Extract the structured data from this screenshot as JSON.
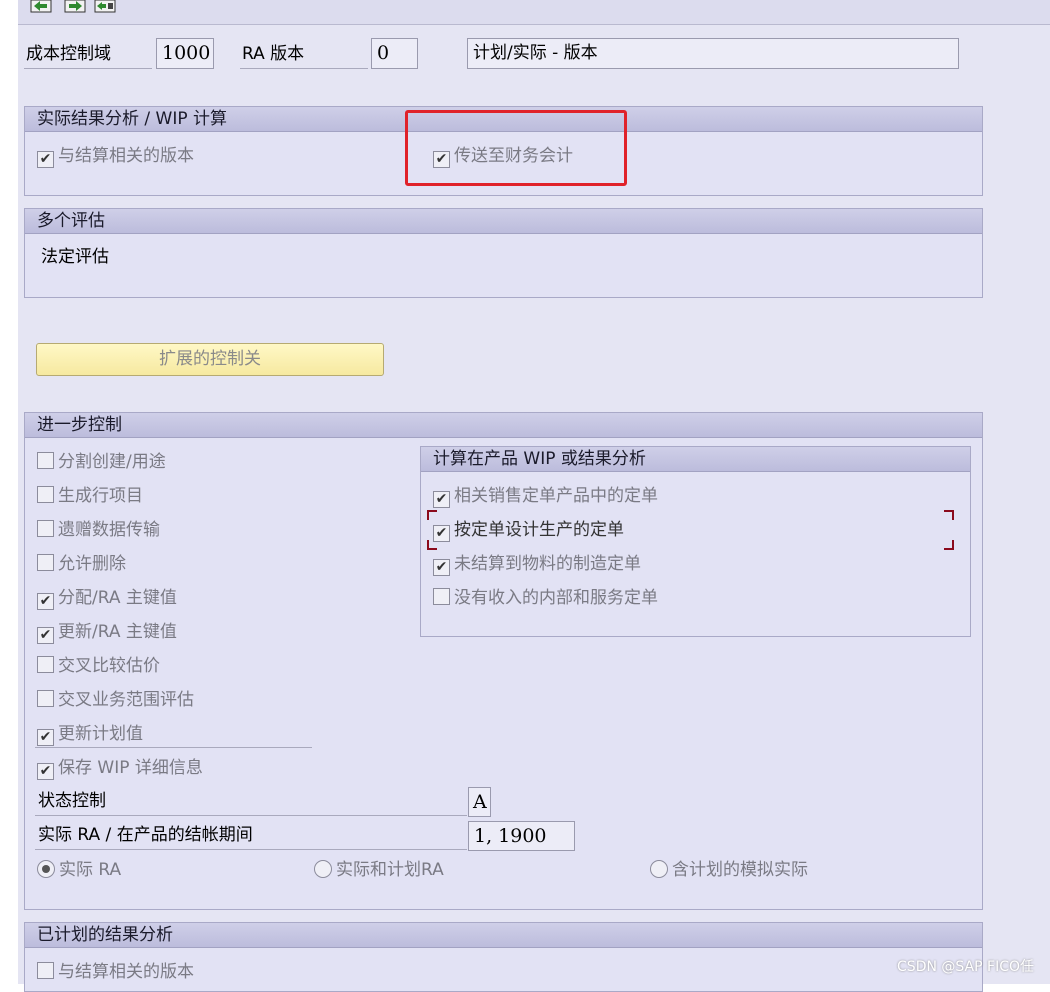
{
  "header": {
    "controlling_area_label": "成本控制域",
    "controlling_area_value": "1000",
    "ra_version_label": "RA 版本",
    "ra_version_value": "0",
    "version_desc": "计划/实际 - 版本"
  },
  "actual_ra": {
    "title": "实际结果分析 / WIP 计算",
    "settlement_version": "与结算相关的版本",
    "transfer_fi": "传送至财务会计"
  },
  "multi_valuation": {
    "title": "多个评估",
    "legal_valuation": "法定评估"
  },
  "extended_button": "扩展的控制关",
  "further_control": {
    "title": "进一步控制",
    "items": [
      {
        "label": "分割创建/用途",
        "checked": false
      },
      {
        "label": "生成行项目",
        "checked": false
      },
      {
        "label": "遗赠数据传输",
        "checked": false
      },
      {
        "label": "允许删除",
        "checked": false
      },
      {
        "label": "分配/RA 主键值",
        "checked": true
      },
      {
        "label": "更新/RA 主键值",
        "checked": true
      },
      {
        "label": "交叉比较估价",
        "checked": false
      },
      {
        "label": "交叉业务范围评估",
        "checked": false
      },
      {
        "label": "更新计划值",
        "checked": true
      },
      {
        "label": "保存 WIP 详细信息",
        "checked": true
      }
    ],
    "status_control_label": "状态控制",
    "status_control_value": "A",
    "period_label": "实际 RA / 在产品的结帐期间",
    "period_value": "1, 1900",
    "radio_actual": "实际 RA",
    "radio_actual_plan": "实际和计划RA",
    "radio_simulated": "含计划的模拟实际"
  },
  "wip_calc": {
    "title": "计算在产品 WIP 或结果分析",
    "items": [
      {
        "label": "相关销售定单产品中的定单",
        "checked": true
      },
      {
        "label": "按定单设计生产的定单",
        "checked": true
      },
      {
        "label": "未结算到物料的制造定单",
        "checked": true
      },
      {
        "label": "没有收入的内部和服务定单",
        "checked": false
      }
    ]
  },
  "planned_ra": {
    "title": "已计划的结果分析",
    "settlement_version": "与结算相关的版本"
  },
  "watermark": "CSDN @SAP FICO任",
  "colors": {
    "highlight_red": "#e0222a",
    "group_bg": "#e2e2f4",
    "button_yellow": "#fff3b0"
  }
}
